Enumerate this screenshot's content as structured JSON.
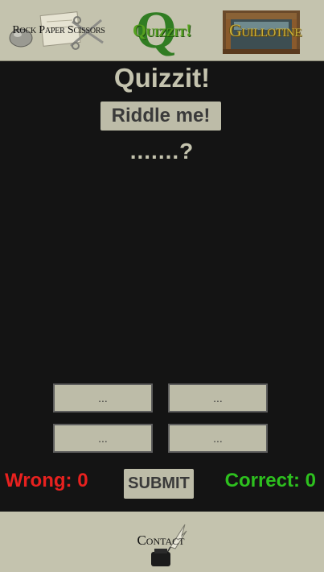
{
  "nav": {
    "rps_label": "Rock Paper Scissors",
    "quizzit_letter": "Q",
    "quizzit_label": "Quizzit!",
    "guillotine_label": "Guillotine"
  },
  "game": {
    "title": "Quizzit!",
    "riddle_button": "Riddle me!",
    "question": ".......?",
    "answers": [
      "...",
      "...",
      "...",
      "..."
    ],
    "submit_label": "SUBMIT",
    "wrong": "Wrong: 0",
    "correct": "Correct: 0"
  },
  "footer": {
    "contact_label": "Contact"
  },
  "colors": {
    "background": "#141414",
    "panel": "#c4c3ae",
    "button": "#bdbca8",
    "wrong": "#e8211f",
    "correct": "#2dc01e",
    "quizzit_green": "#2a7a1c"
  },
  "icons": {
    "rps": "rock-paper-scissors-art",
    "guillotine": "guillotine-art",
    "contact": "quill-inkwell-icon"
  }
}
